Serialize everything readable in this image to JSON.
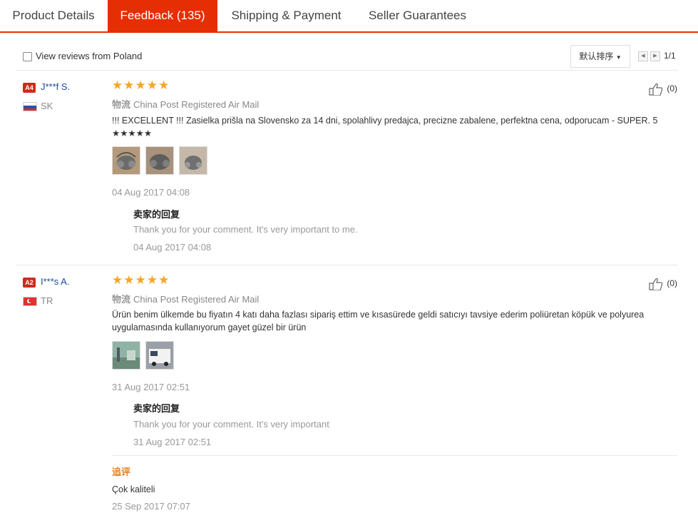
{
  "tabs": [
    {
      "label": "Product Details"
    },
    {
      "label": "Feedback (135)"
    },
    {
      "label": "Shipping & Payment"
    },
    {
      "label": "Seller Guarantees"
    }
  ],
  "filter": {
    "checkbox_label": "View reviews from Poland",
    "sort_label": "默认排序",
    "page": "1/1"
  },
  "reviews": [
    {
      "badge": "A4",
      "user": "J***f S.",
      "country": "SK",
      "stars": "★★★★★",
      "ship_label": "物流",
      "ship_method": "China Post Registered Air Mail",
      "text": "!!! EXCELLENT !!! Zasielka prišla na Slovensko za 14 dni, spolahlivy predajca, precizne zabalene, perfektna cena, odporucam - SUPER. 5 ★★★★★",
      "date": "04 Aug 2017 04:08",
      "reply_title": "卖家的回复",
      "reply_text": "Thank you for your comment. It's very important to me.",
      "reply_date": "04 Aug 2017 04:08",
      "likes": "(0)"
    },
    {
      "badge": "A2",
      "user": "I***s A.",
      "country": "TR",
      "stars": "★★★★★",
      "ship_label": "物流",
      "ship_method": "China Post Registered Air Mail",
      "text": "Ürün benim ülkemde bu fiyatın 4 katı daha fazlası sipariş ettim ve kısasürede geldi satıcıyı tavsiye ederim poliüretan köpük ve polyurea uygulamasında kullanıyorum gayet güzel bir ürün",
      "date": "31 Aug 2017 02:51",
      "reply_title": "卖家的回复",
      "reply_text": "Thank you for your comment. It's very important",
      "reply_date": "31 Aug 2017 02:51",
      "likes": "(0)",
      "followup_label": "追评",
      "followup_text": "Çok kaliteli",
      "followup_date": "25 Sep 2017 07:07"
    }
  ],
  "colors": {
    "accent": "#e62e04",
    "star": "#f5a623",
    "link": "#1a4a9c"
  }
}
